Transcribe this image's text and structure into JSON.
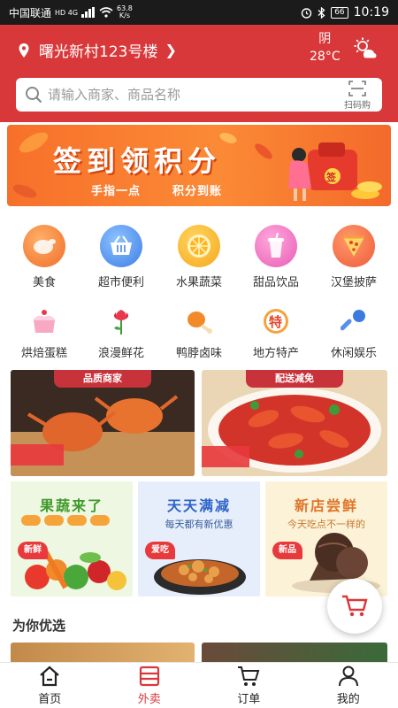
{
  "status_bar": {
    "carrier": "中国联通",
    "network": "HD 4G",
    "speed_value": "63.8",
    "speed_unit": "K/s",
    "battery": "66",
    "time": "10:19"
  },
  "header": {
    "location": "曙光新村123号楼",
    "weather_condition": "阴",
    "temperature": "28°C",
    "search_placeholder": "请输入商家、商品名称",
    "scan_label": "扫码购",
    "accent_color": "#d9383a"
  },
  "banner": {
    "title": "签到领积分",
    "subtitle_left": "手指一点",
    "subtitle_right": "积分到账"
  },
  "categories_row1": [
    {
      "label": "美食",
      "icon": "roast-chicken-icon"
    },
    {
      "label": "超市便利",
      "icon": "shopping-basket-icon"
    },
    {
      "label": "水果蔬菜",
      "icon": "orange-slice-icon"
    },
    {
      "label": "甜品饮品",
      "icon": "drink-cup-icon"
    },
    {
      "label": "汉堡披萨",
      "icon": "pizza-icon"
    }
  ],
  "categories_row2": [
    {
      "label": "烘焙蛋糕",
      "icon": "cake-icon"
    },
    {
      "label": "浪漫鲜花",
      "icon": "flower-icon"
    },
    {
      "label": "鸭脖卤味",
      "icon": "drumstick-icon"
    },
    {
      "label": "地方特产",
      "icon": "specialty-badge-icon"
    },
    {
      "label": "休闲娱乐",
      "icon": "microphone-icon"
    }
  ],
  "promos": [
    {
      "tag": "品质商家"
    },
    {
      "tag": "配送减免"
    }
  ],
  "tiles": [
    {
      "title": "果蔬来了",
      "subtitle": "",
      "badge": "新鲜"
    },
    {
      "title": "天天满减",
      "subtitle": "每天都有新优惠",
      "badge": "爱吃"
    },
    {
      "title": "新店尝鲜",
      "subtitle": "今天吃点不一样的",
      "badge": "新品"
    }
  ],
  "section_title": "为你优选",
  "tabbar": [
    {
      "label": "首页",
      "icon": "home-icon",
      "active": false
    },
    {
      "label": "外卖",
      "icon": "takeout-icon",
      "active": true
    },
    {
      "label": "订单",
      "icon": "cart-icon",
      "active": false
    },
    {
      "label": "我的",
      "icon": "user-icon",
      "active": false
    }
  ]
}
